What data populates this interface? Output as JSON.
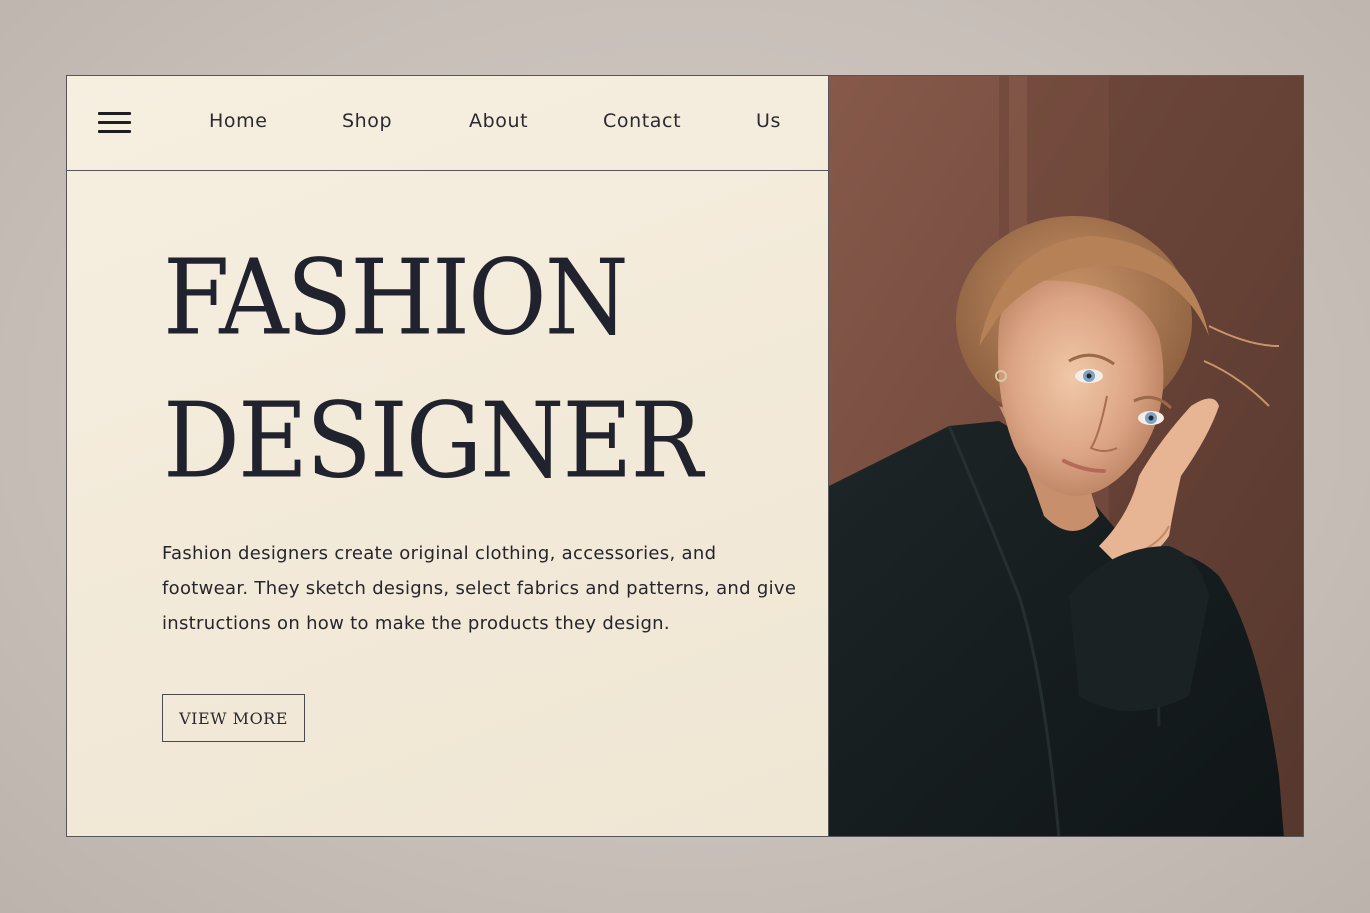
{
  "nav": {
    "menu_icon": "hamburger-menu-icon",
    "items": [
      {
        "label": "Home"
      },
      {
        "label": "Shop"
      },
      {
        "label": "About"
      },
      {
        "label": "Contact"
      },
      {
        "label": "Us"
      }
    ]
  },
  "hero": {
    "title_line1": "FASHION",
    "title_line2": "DESIGNER",
    "description": "Fashion designers create original clothing, accessories, and footwear. They sketch designs, select fabrics and patterns, and give instructions on how to make the products they design.",
    "button_label": "VIEW MORE"
  },
  "colors": {
    "background": "#c9c1ba",
    "panel": "#f3ebdc",
    "text": "#20222e",
    "border": "#55555a"
  }
}
